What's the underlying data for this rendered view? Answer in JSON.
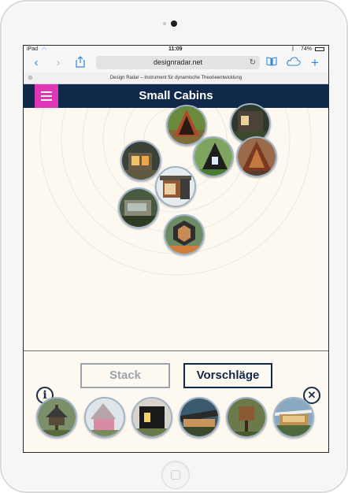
{
  "status": {
    "device": "iPad",
    "time": "11:09",
    "battery": "74%"
  },
  "browser": {
    "url": "designradar.net",
    "tab_title": "Design Radar – Instrument für dynamische Theorieentwicklung"
  },
  "app": {
    "title": "Small Cabins"
  },
  "buttons": {
    "stack_label": "Stack",
    "suggestions_label": "Vorschläge"
  },
  "colors": {
    "header": "#10284a",
    "menu_accent": "#e036b5",
    "background": "#fdf8f0"
  },
  "icons": {
    "menu": "hamburger-icon",
    "info": "info-icon",
    "close": "close-icon",
    "back": "chevron-left-icon",
    "forward": "chevron-right-icon",
    "share": "share-icon",
    "bookmarks": "book-icon",
    "cloud": "cloud-icon",
    "new_tab": "plus-icon",
    "reload": "reload-icon"
  },
  "radar_items": [
    {
      "name": "cabin-a-frame"
    },
    {
      "name": "cabin-dark-trees"
    },
    {
      "name": "cabin-glass-box"
    },
    {
      "name": "cabin-green-triangle"
    },
    {
      "name": "cabin-timber-aframe"
    },
    {
      "name": "cabin-modern-cube"
    },
    {
      "name": "cabin-forest-block"
    },
    {
      "name": "cabin-hexagon"
    }
  ],
  "tray_items": [
    {
      "name": "cabin-treehouse"
    },
    {
      "name": "cabin-pink-gable"
    },
    {
      "name": "cabin-black-box"
    },
    {
      "name": "cabin-long-lodge"
    },
    {
      "name": "cabin-tree-platform"
    },
    {
      "name": "cabin-white-pavilion"
    }
  ]
}
